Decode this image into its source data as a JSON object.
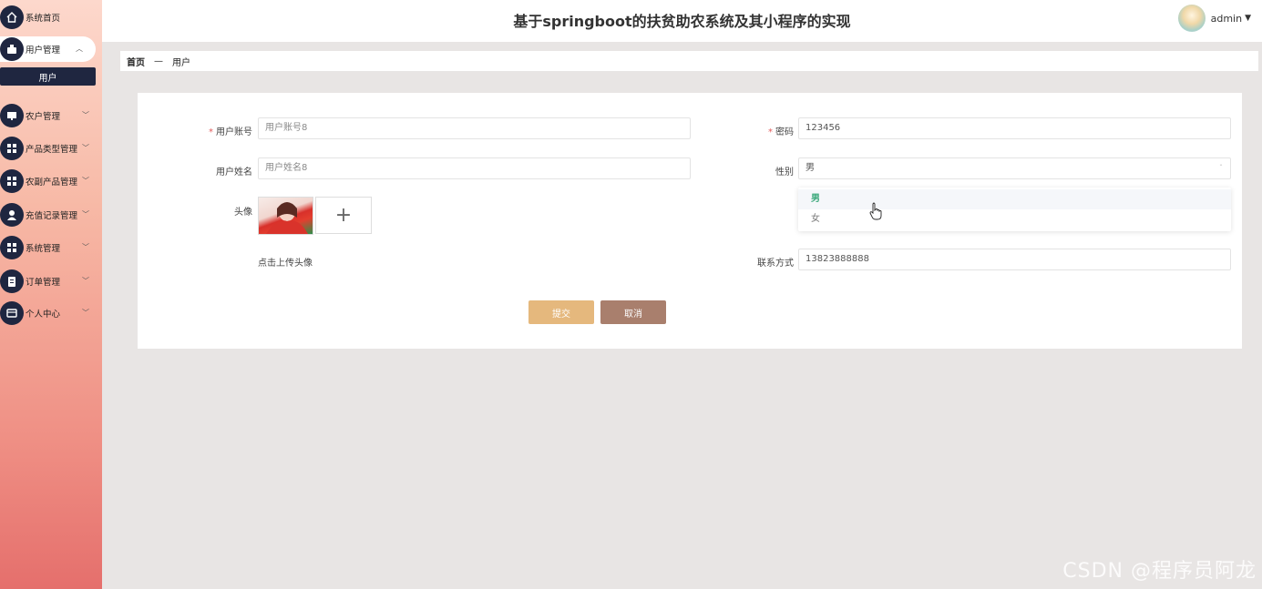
{
  "app": {
    "title": "基于springboot的扶贫助农系统及其小程序的实现",
    "user": "admin"
  },
  "sidebar": {
    "items": [
      {
        "label": "系统首页",
        "icon": "home-icon"
      },
      {
        "label": "用户管理",
        "icon": "user-admin-icon"
      },
      {
        "label": "农户管理",
        "icon": "monitor-icon"
      },
      {
        "label": "产品类型管理",
        "icon": "grid-icon"
      },
      {
        "label": "农副产品管理",
        "icon": "grid-icon"
      },
      {
        "label": "充值记录管理",
        "icon": "person-icon"
      },
      {
        "label": "系统管理",
        "icon": "grid-icon"
      },
      {
        "label": "订单管理",
        "icon": "clipboard-icon"
      },
      {
        "label": "个人中心",
        "icon": "card-icon"
      }
    ],
    "submenu": "用户"
  },
  "breadcrumb": {
    "home": "首页",
    "sep": "—",
    "current": "用户"
  },
  "form": {
    "account_label": "用户账号",
    "account_value": "用户账号8",
    "password_label": "密码",
    "password_value": "123456",
    "name_label": "用户姓名",
    "name_value": "用户姓名8",
    "gender_label": "性别",
    "gender_value": "男",
    "avatar_label": "头像",
    "avatar_hint": "点击上传头像",
    "phone_label": "联系方式",
    "phone_value": "13823888888",
    "gender_options": [
      "男",
      "女"
    ],
    "required_mark": "*",
    "submit": "提交",
    "cancel": "取消"
  },
  "watermark": "CSDN @程序员阿龙"
}
